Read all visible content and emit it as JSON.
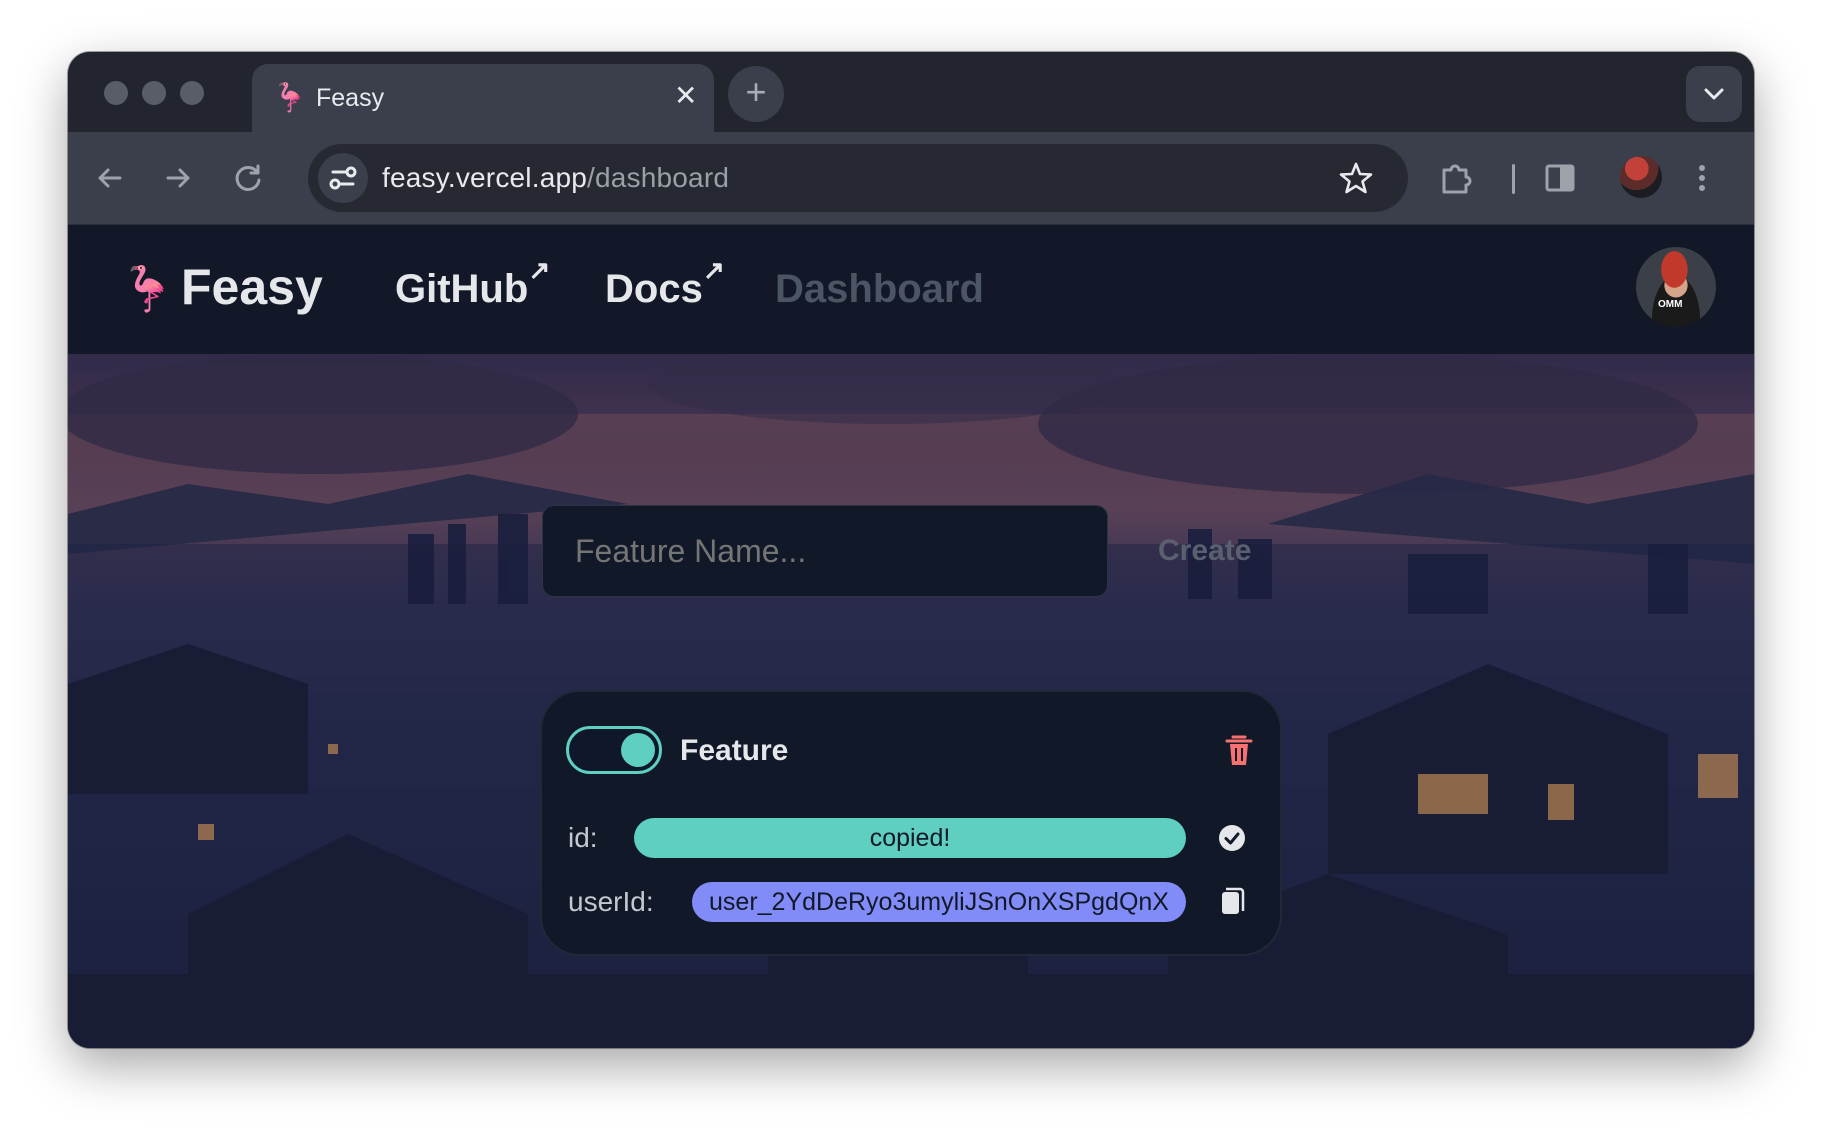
{
  "browser": {
    "tab": {
      "title": "Feasy",
      "favicon": "flamingo-icon",
      "close_glyph": "✕"
    },
    "new_tab_glyph": "+",
    "address": {
      "host": "feasy.vercel.app",
      "path": "/dashboard"
    }
  },
  "site": {
    "brand": "Feasy",
    "brand_icon": "🦩",
    "nav": [
      {
        "label": "GitHub",
        "external": true
      },
      {
        "label": "Docs",
        "external": true
      },
      {
        "label": "Dashboard",
        "external": false
      }
    ],
    "external_glyph": "↗",
    "avatar_text": "OMM"
  },
  "form": {
    "placeholder": "Feature Name...",
    "create_label": "Create"
  },
  "feature_card": {
    "enabled": true,
    "name": "Feature",
    "id_label": "id:",
    "id_value": "copied!",
    "user_label": "userId:",
    "user_value": "user_2YdDeRyo3umyliJSnOnXSPgdQnX"
  },
  "colors": {
    "accent_teal": "#5ecfc0",
    "accent_indigo": "#818cf8",
    "danger": "#f87171",
    "header_bg": "#121827"
  }
}
